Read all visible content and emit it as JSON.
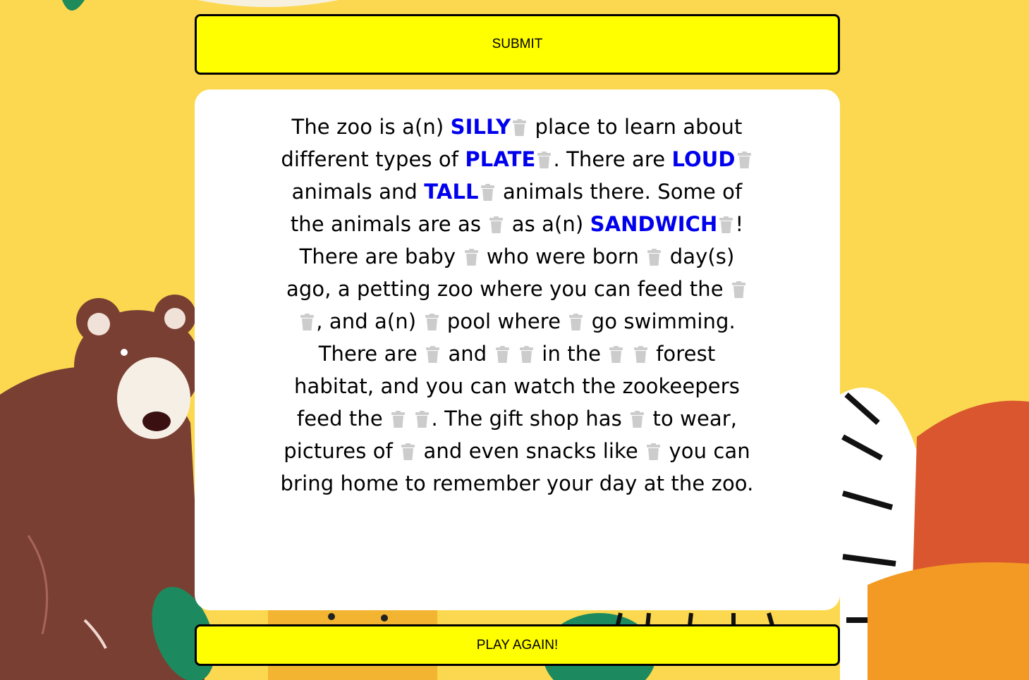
{
  "buttons": {
    "submit_label": "SUBMIT",
    "play_again_label": "PLAY AGAIN!"
  },
  "story": {
    "s1": "The zoo is a(n)",
    "w1": "SILLY",
    "s2": "place to learn about different types of",
    "w2": "PLATE",
    "s3": ". There are",
    "w3": "LOUD",
    "s4": "animals and",
    "w4": "TALL",
    "s5": "animals there. Some of the animals are as",
    "s6": "as a(n)",
    "w5": "SANDWICH",
    "s7": "! There are baby",
    "s8": "who were born",
    "s9": "day(s) ago, a petting zoo where you can feed the",
    "s10": ", and a(n)",
    "s11": "pool where",
    "s12": "go swimming. There are",
    "s13": "and",
    "s14": "in the",
    "s15": "forest habitat, and you can watch the zookeepers feed the",
    "s16": ". The gift shop has",
    "s17": "to wear, pictures of",
    "s18": "and even snacks like",
    "s19": "you can bring home to remember your day at the zoo."
  },
  "icons": {
    "delete": "trash-icon"
  },
  "colors": {
    "background": "#fbd84f",
    "button": "#ffff00",
    "filled_word": "#0000ee",
    "trash_icon": "#cccccc"
  }
}
